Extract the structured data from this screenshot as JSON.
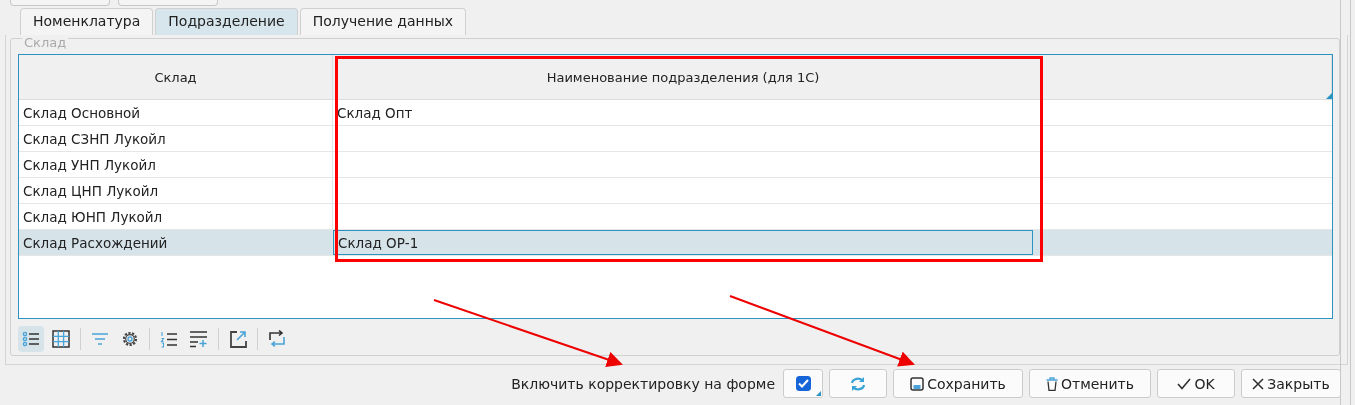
{
  "tabs": [
    {
      "label": "Номенклатура",
      "selected": false
    },
    {
      "label": "Подразделение",
      "selected": true
    },
    {
      "label": "Получение данных",
      "selected": false
    }
  ],
  "group": {
    "title": "Склад"
  },
  "table": {
    "columns": [
      "Склад",
      "Наименование подразделения (для 1С)"
    ],
    "rows": [
      {
        "cells": [
          "Склад Основной",
          "Склад Опт"
        ],
        "selected": false
      },
      {
        "cells": [
          "Склад СЗНП Лукойл",
          ""
        ],
        "selected": false
      },
      {
        "cells": [
          "Склад УНП Лукойл",
          ""
        ],
        "selected": false
      },
      {
        "cells": [
          "Склад ЦНП Лукойл",
          ""
        ],
        "selected": false
      },
      {
        "cells": [
          "Склад ЮНП Лукойл",
          ""
        ],
        "selected": false
      },
      {
        "cells": [
          "Склад Расхождений",
          "Склад ОР-1"
        ],
        "selected": true
      }
    ]
  },
  "toolbar": [
    {
      "kind": "list",
      "selected": true
    },
    {
      "kind": "grid",
      "selected": false
    },
    {
      "kind": "filter",
      "selected": false
    },
    {
      "kind": "settings",
      "selected": false
    },
    {
      "kind": "numbered",
      "selected": false
    },
    {
      "kind": "add-row",
      "selected": false
    },
    {
      "kind": "export",
      "selected": false
    },
    {
      "kind": "swap",
      "selected": false
    }
  ],
  "footer": {
    "checkbox_label": "Включить корректировку на форме",
    "checked": true,
    "buttons": [
      {
        "kind": "refresh"
      },
      {
        "kind": "save",
        "label": "Сохранить"
      },
      {
        "kind": "cancel",
        "label": "Отменить"
      },
      {
        "kind": "ok",
        "label": "OK"
      },
      {
        "kind": "close",
        "label": "Закрыть"
      }
    ]
  }
}
